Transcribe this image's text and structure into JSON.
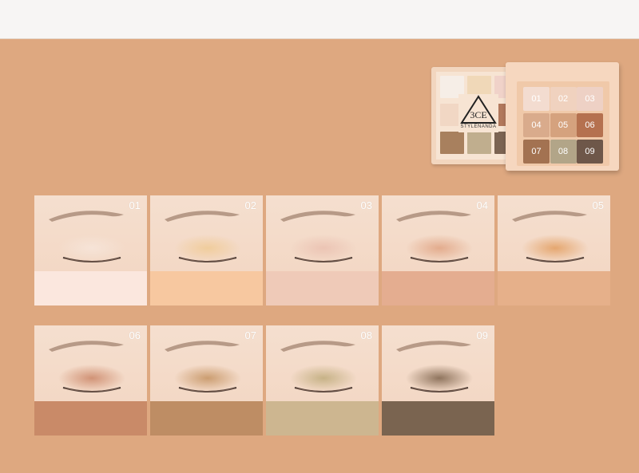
{
  "palette": {
    "brand_mark": "3CE",
    "brand_text": "STYLENANDA",
    "pans": [
      {
        "label": "01",
        "color": "#f3dcd0"
      },
      {
        "label": "02",
        "color": "#f0d2bf"
      },
      {
        "label": "03",
        "color": "#eed1c5"
      },
      {
        "label": "04",
        "color": "#d9ab8c"
      },
      {
        "label": "05",
        "color": "#d5a27e"
      },
      {
        "label": "06",
        "color": "#b5714f"
      },
      {
        "label": "07",
        "color": "#a37251"
      },
      {
        "label": "08",
        "color": "#b2a588"
      },
      {
        "label": "09",
        "color": "#6e5749"
      }
    ],
    "back_pans": [
      "#f6eee7",
      "#f0d8b8",
      "#f0d2c9",
      "#f1d7c4",
      "#e9b594",
      "#b1785c",
      "#a8805e",
      "#c0ae8e",
      "#7b6352"
    ]
  },
  "swatches": [
    {
      "label": "01",
      "color": "#fbe7de",
      "lid": "#f6e4d8"
    },
    {
      "label": "02",
      "color": "#f7c8a0",
      "lid": "#f0cc9a"
    },
    {
      "label": "03",
      "color": "#efcab8",
      "lid": "#ebc3b3"
    },
    {
      "label": "04",
      "color": "#e4ad90",
      "lid": "#e2a98a"
    },
    {
      "label": "05",
      "color": "#e6b08a",
      "lid": "#e4a46b"
    },
    {
      "label": "06",
      "color": "#c98a68",
      "lid": "#cf8f72"
    },
    {
      "label": "07",
      "color": "#be8d64",
      "lid": "#c99a6c"
    },
    {
      "label": "08",
      "color": "#cdb690",
      "lid": "#c4b083"
    },
    {
      "label": "09",
      "color": "#7a6450",
      "lid": "#8a6f58"
    }
  ]
}
